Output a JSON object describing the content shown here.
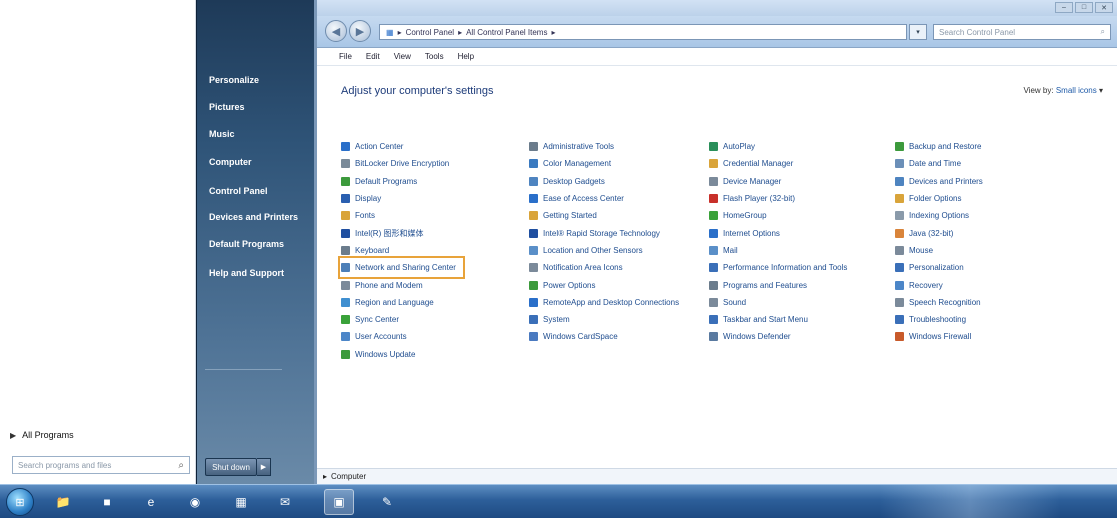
{
  "start_menu": {
    "right_items": [
      "Personalize",
      "Pictures",
      "Music",
      "Computer",
      "Control Panel",
      "Devices and Printers",
      "Default Programs",
      "Help and Support"
    ],
    "all_programs": "All Programs",
    "search_placeholder": "Search programs and files",
    "shutdown_label": "Shut down"
  },
  "window": {
    "address": [
      "Control Panel",
      "All Control Panel Items"
    ],
    "search_placeholder": "Search Control Panel",
    "menu": [
      "File",
      "Edit",
      "View",
      "Tools",
      "Help"
    ],
    "heading": "Adjust your computer's settings",
    "view_by_label": "View by:",
    "view_by_value": "Small icons",
    "status_text": "Computer"
  },
  "control_panel": {
    "columns": [
      [
        {
          "label": "Action Center",
          "color": "#2a6fc9"
        },
        {
          "label": "BitLocker Drive Encryption",
          "color": "#7a8a99"
        },
        {
          "label": "Default Programs",
          "color": "#3c9a3c"
        },
        {
          "label": "Display",
          "color": "#2a5fb0"
        },
        {
          "label": "Fonts",
          "color": "#d9a43a"
        },
        {
          "label": "Intel(R) 图形和媒体",
          "color": "#1f4fa0"
        },
        {
          "label": "Keyboard",
          "color": "#6b7c8c"
        },
        {
          "label": "Network and Sharing Center",
          "color": "#4c7fb8",
          "highlight": true
        },
        {
          "label": "Phone and Modem",
          "color": "#7b8a9a"
        },
        {
          "label": "Region and Language",
          "color": "#3f8fd0"
        },
        {
          "label": "Sync Center",
          "color": "#3aa23a"
        },
        {
          "label": "User Accounts",
          "color": "#4c86c8"
        },
        {
          "label": "Windows Update",
          "color": "#3c9a3c"
        }
      ],
      [
        {
          "label": "Administrative Tools",
          "color": "#6b7c8c"
        },
        {
          "label": "Color Management",
          "color": "#3a7ac0"
        },
        {
          "label": "Desktop Gadgets",
          "color": "#4e84c0"
        },
        {
          "label": "Ease of Access Center",
          "color": "#2a6fc9"
        },
        {
          "label": "Getting Started",
          "color": "#d9a43a"
        },
        {
          "label": "Intel® Rapid Storage Technology",
          "color": "#1f4fa0"
        },
        {
          "label": "Location and Other Sensors",
          "color": "#5a8fc8"
        },
        {
          "label": "Notification Area Icons",
          "color": "#7b8a9a"
        },
        {
          "label": "Power Options",
          "color": "#3c9a3c"
        },
        {
          "label": "RemoteApp and Desktop Connections",
          "color": "#2a6fc9"
        },
        {
          "label": "System",
          "color": "#3a6fb8"
        },
        {
          "label": "Windows CardSpace",
          "color": "#4a7ac0"
        }
      ],
      [
        {
          "label": "AutoPlay",
          "color": "#2a8f5a"
        },
        {
          "label": "Credential Manager",
          "color": "#d9a43a"
        },
        {
          "label": "Device Manager",
          "color": "#7b8a9a"
        },
        {
          "label": "Flash Player (32-bit)",
          "color": "#c8302a"
        },
        {
          "label": "HomeGroup",
          "color": "#3aa23a"
        },
        {
          "label": "Internet Options",
          "color": "#2a6fc9"
        },
        {
          "label": "Mail",
          "color": "#5a8fc8"
        },
        {
          "label": "Performance Information and Tools",
          "color": "#3a6fb8"
        },
        {
          "label": "Programs and Features",
          "color": "#6b7c8c"
        },
        {
          "label": "Sound",
          "color": "#7b8a9a"
        },
        {
          "label": "Taskbar and Start Menu",
          "color": "#3a6fb8"
        },
        {
          "label": "Windows Defender",
          "color": "#5a7aa0"
        }
      ],
      [
        {
          "label": "Backup and Restore",
          "color": "#3c9a3c"
        },
        {
          "label": "Date and Time",
          "color": "#6b8fb8"
        },
        {
          "label": "Devices and Printers",
          "color": "#4e84c0"
        },
        {
          "label": "Folder Options",
          "color": "#d9a43a"
        },
        {
          "label": "Indexing Options",
          "color": "#8a9aaa"
        },
        {
          "label": "Java (32-bit)",
          "color": "#d9843a"
        },
        {
          "label": "Mouse",
          "color": "#7b8a9a"
        },
        {
          "label": "Personalization",
          "color": "#3a6fb8"
        },
        {
          "label": "Recovery",
          "color": "#4c86c8"
        },
        {
          "label": "Speech Recognition",
          "color": "#7b8a9a"
        },
        {
          "label": "Troubleshooting",
          "color": "#3a6fb8"
        },
        {
          "label": "Windows Firewall",
          "color": "#c85a2a"
        }
      ]
    ]
  },
  "taskbar": {
    "items": [
      {
        "icon": "📁"
      },
      {
        "icon": "■"
      },
      {
        "icon": "e"
      },
      {
        "icon": "◉"
      },
      {
        "icon": "▦"
      },
      {
        "icon": "✉"
      },
      {
        "icon": "▣",
        "active": true
      },
      {
        "icon": "✎"
      }
    ]
  }
}
